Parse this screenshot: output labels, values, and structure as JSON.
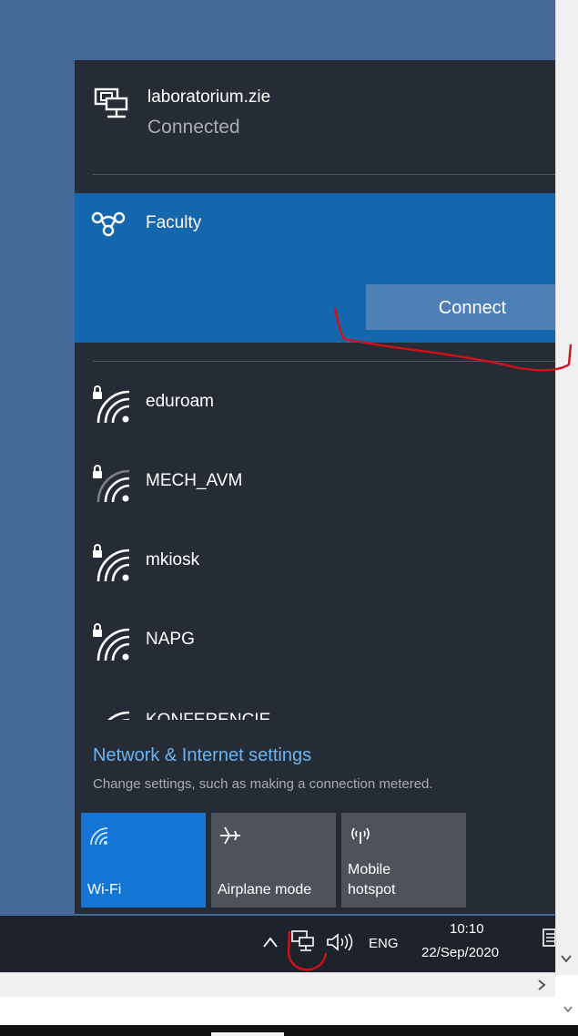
{
  "flyout": {
    "ethernet": {
      "name": "laboratorium.zie",
      "status": "Connected"
    },
    "selected_network": {
      "name": "Faculty",
      "connect_label": "Connect"
    },
    "networks": [
      {
        "name": "eduroam",
        "secured": true
      },
      {
        "name": "MECH_AVM",
        "secured": true
      },
      {
        "name": "mkiosk",
        "secured": true
      },
      {
        "name": "NAPG",
        "secured": true
      },
      {
        "name": "KONFERENCIE",
        "secured": true
      }
    ],
    "settings": {
      "link": "Network & Internet settings",
      "description": "Change settings, such as making a connection metered."
    },
    "quick_actions": [
      {
        "label": "Wi-Fi",
        "icon": "wifi-icon",
        "active": true
      },
      {
        "label": "Airplane mode",
        "icon": "airplane-icon",
        "active": false
      },
      {
        "label": "Mobile\nhotspot",
        "icon": "hotspot-icon",
        "active": false
      }
    ]
  },
  "taskbar": {
    "language": "ENG",
    "time": "10:10",
    "date": "22/Sep/2020"
  },
  "colors": {
    "flyout_bg": "#262c36",
    "selected_bg": "#1467ad",
    "accent": "#1476d4",
    "link": "#6db3ef",
    "annotation": "#d0101a"
  }
}
